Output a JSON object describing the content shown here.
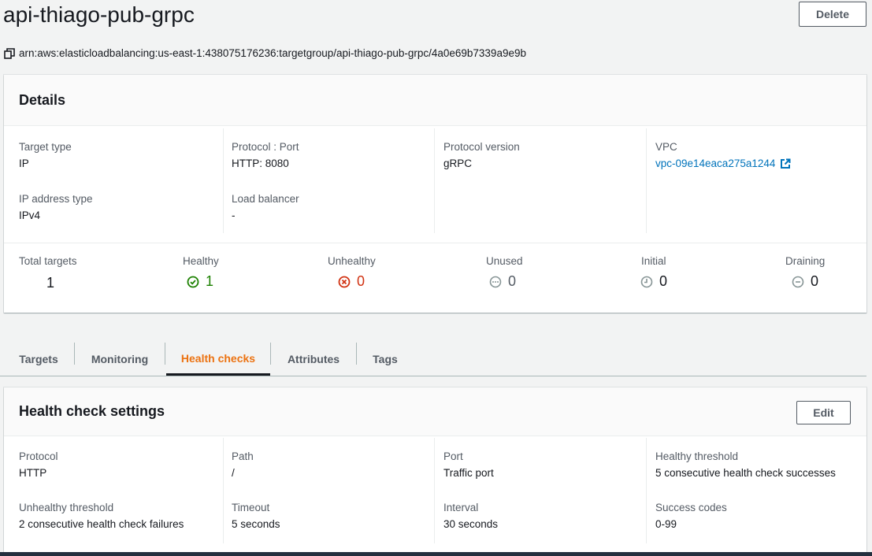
{
  "page": {
    "title": "api-thiago-pub-grpc",
    "delete_label": "Delete",
    "arn": "arn:aws:elasticloadbalancing:us-east-1:438075176236:targetgroup/api-thiago-pub-grpc/4a0e69b7339a9e9b"
  },
  "details": {
    "title": "Details",
    "target_type": {
      "label": "Target type",
      "value": "IP"
    },
    "protocol_port": {
      "label": "Protocol : Port",
      "value": "HTTP: 8080"
    },
    "protocol_version": {
      "label": "Protocol version",
      "value": "gRPC"
    },
    "vpc": {
      "label": "VPC",
      "value": "vpc-09e14eaca275a1244"
    },
    "ip_address_type": {
      "label": "IP address type",
      "value": "IPv4"
    },
    "load_balancer": {
      "label": "Load balancer",
      "value": "-"
    },
    "summary": {
      "total": {
        "label": "Total targets",
        "value": "1"
      },
      "healthy": {
        "label": "Healthy",
        "value": "1",
        "color": "#1d8102"
      },
      "unhealthy": {
        "label": "Unhealthy",
        "value": "0",
        "color": "#d13212"
      },
      "unused": {
        "label": "Unused",
        "value": "0",
        "color": "#879596"
      },
      "initial": {
        "label": "Initial",
        "value": "0",
        "color": "#879596"
      },
      "draining": {
        "label": "Draining",
        "value": "0",
        "color": "#879596"
      }
    }
  },
  "tabs": [
    {
      "label": "Targets",
      "active": false
    },
    {
      "label": "Monitoring",
      "active": false
    },
    {
      "label": "Health checks",
      "active": true
    },
    {
      "label": "Attributes",
      "active": false
    },
    {
      "label": "Tags",
      "active": false
    }
  ],
  "health_check": {
    "title": "Health check settings",
    "edit_label": "Edit",
    "protocol": {
      "label": "Protocol",
      "value": "HTTP"
    },
    "path": {
      "label": "Path",
      "value": "/"
    },
    "port": {
      "label": "Port",
      "value": "Traffic port"
    },
    "healthy_threshold": {
      "label": "Healthy threshold",
      "value": "5 consecutive health check successes"
    },
    "unhealthy_threshold": {
      "label": "Unhealthy threshold",
      "value": "2 consecutive health check failures"
    },
    "timeout": {
      "label": "Timeout",
      "value": "5 seconds"
    },
    "interval": {
      "label": "Interval",
      "value": "30 seconds"
    },
    "success_codes": {
      "label": "Success codes",
      "value": "0-99"
    }
  },
  "colors": {
    "accent": "#ec7211",
    "link": "#0073bb"
  }
}
